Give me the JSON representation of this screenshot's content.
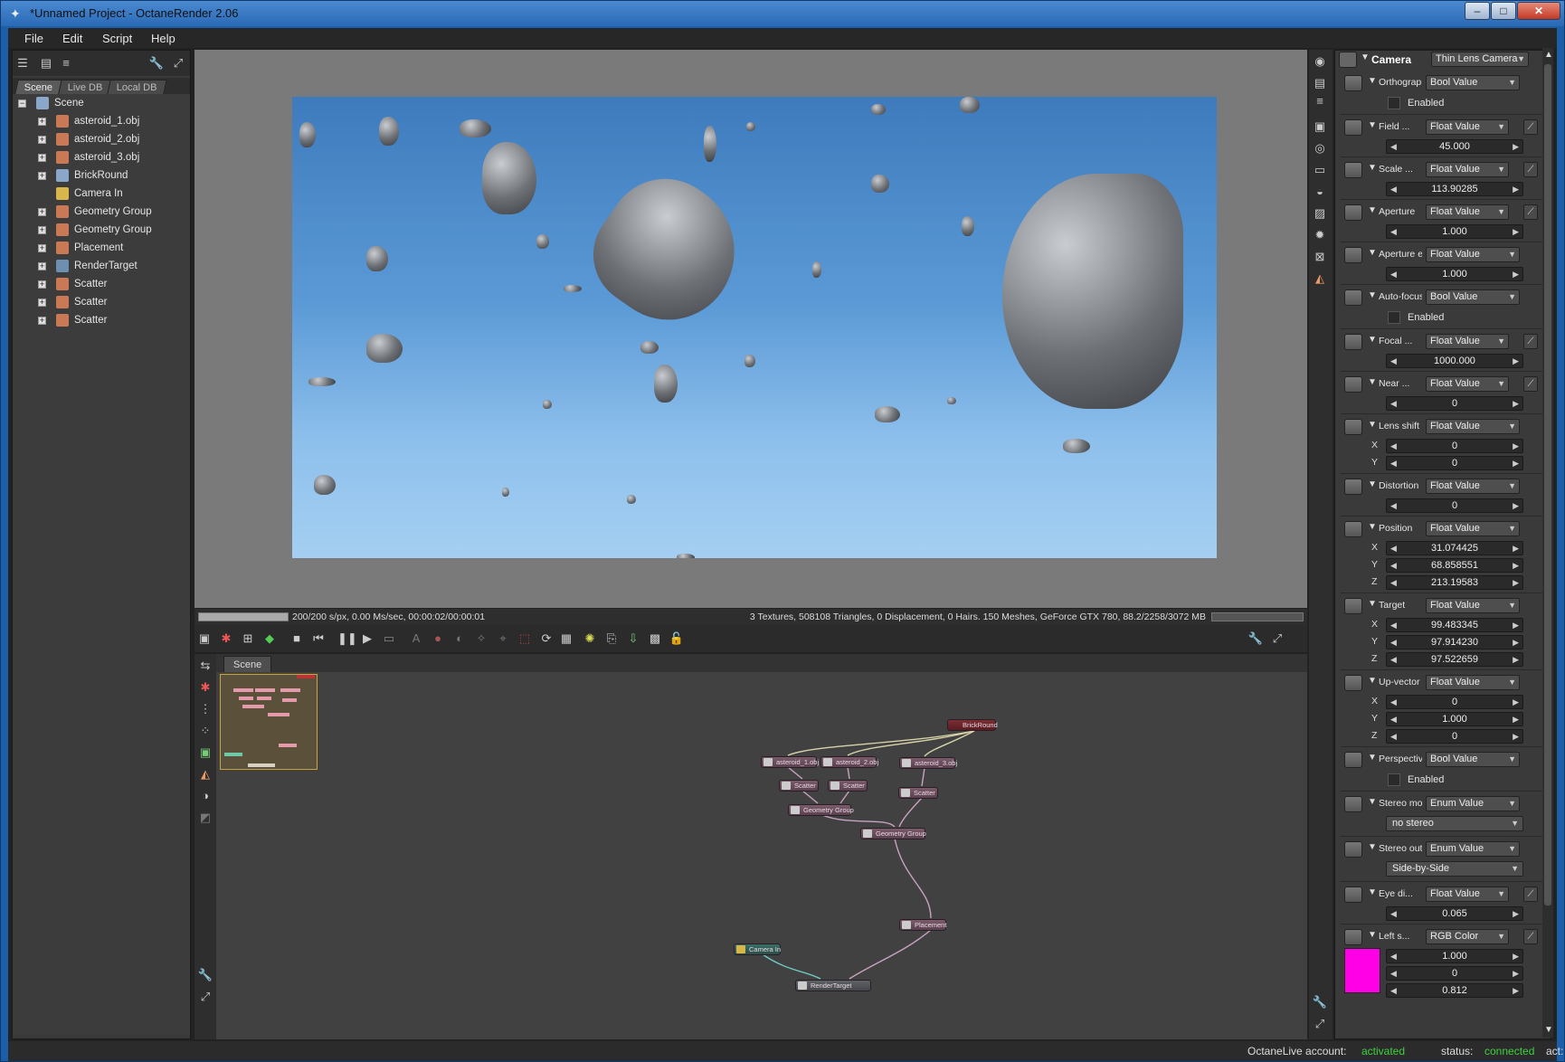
{
  "window": {
    "title": "*Unnamed Project - OctaneRender 2.06",
    "min": "–",
    "max": "□",
    "close": "✕"
  },
  "menu": [
    "File",
    "Edit",
    "Script",
    "Help"
  ],
  "left_panel": {
    "tabs": [
      "Scene",
      "Live DB",
      "Local DB"
    ],
    "tree": [
      {
        "label": "Scene",
        "expander": "−",
        "icon_color": "#8aa6c8"
      },
      {
        "label": "asteroid_1.obj",
        "expander": "+",
        "icon_color": "#c97a55"
      },
      {
        "label": "asteroid_2.obj",
        "expander": "+",
        "icon_color": "#c97a55"
      },
      {
        "label": "asteroid_3.obj",
        "expander": "+",
        "icon_color": "#c97a55"
      },
      {
        "label": "BrickRound",
        "expander": "+",
        "icon_color": "#8aa6c8"
      },
      {
        "label": "Camera In",
        "expander": "",
        "icon_color": "#d9b64a"
      },
      {
        "label": "Geometry Group",
        "expander": "+",
        "icon_color": "#c97a55"
      },
      {
        "label": "Geometry Group",
        "expander": "+",
        "icon_color": "#c97a55"
      },
      {
        "label": "Placement",
        "expander": "+",
        "icon_color": "#c97a55"
      },
      {
        "label": "RenderTarget",
        "expander": "+",
        "icon_color": "#6d8fb0"
      },
      {
        "label": "Scatter",
        "expander": "+",
        "icon_color": "#c97a55"
      },
      {
        "label": "Scatter",
        "expander": "+",
        "icon_color": "#c97a55"
      },
      {
        "label": "Scatter",
        "expander": "+",
        "icon_color": "#c97a55"
      }
    ]
  },
  "viewport": {
    "status_left": "200/200 s/px, 0.00 Ms/sec, 00:00:02/00:00:01",
    "status_right": "3 Textures, 508108 Triangles, 0 Displacement, 0 Hairs. 150 Meshes, GeForce GTX 780, 88.2/2258/3072 MB",
    "progress": 1.0
  },
  "graph": {
    "tab": "Scene",
    "nodes": {
      "brickround": "BrickRound",
      "ast1": "asteroid_1.obj",
      "ast2": "asteroid_2.obj",
      "ast3": "asteroid_3.obj",
      "scatter1": "Scatter",
      "scatter2": "Scatter",
      "scatter3": "Scatter",
      "geo1": "Geometry Group",
      "geo2": "Geometry Group",
      "placement": "Placement",
      "camera": "Camera In",
      "rendertarget": "RenderTarget"
    }
  },
  "inspector": {
    "header_label": "Camera",
    "header_type": "Thin Lens Camera",
    "params": {
      "orthographic": {
        "label": "Orthographic",
        "type": "Bool Value",
        "check": "Enabled"
      },
      "field": {
        "label": "Field ...",
        "type": "Float Value",
        "value": "45.000"
      },
      "scale": {
        "label": "Scale ...",
        "type": "Float Value",
        "value": "113.90285"
      },
      "aperture": {
        "label": "Aperture",
        "type": "Float Value",
        "value": "1.000"
      },
      "aperture_edge": {
        "label": "Aperture edge",
        "type": "Float Value",
        "value": "1.000"
      },
      "autofocus": {
        "label": "Auto-focus",
        "type": "Bool Value",
        "check": "Enabled"
      },
      "focal": {
        "label": "Focal ...",
        "type": "Float Value",
        "value": "1000.000"
      },
      "near": {
        "label": "Near ...",
        "type": "Float Value",
        "value": "0"
      },
      "lens_shift": {
        "label": "Lens shift",
        "type": "Float Value",
        "x": "0",
        "y": "0"
      },
      "distortion": {
        "label": "Distortion",
        "type": "Float Value",
        "value": "0"
      },
      "position": {
        "label": "Position",
        "type": "Float Value",
        "x": "31.074425",
        "y": "68.858551",
        "z": "213.19583"
      },
      "target": {
        "label": "Target",
        "type": "Float Value",
        "x": "99.483345",
        "y": "97.914230",
        "z": "97.522659"
      },
      "upvector": {
        "label": "Up-vector",
        "type": "Float Value",
        "x": "0",
        "y": "1.000",
        "z": "0"
      },
      "perspective": {
        "label": "Perspective ...",
        "type": "Bool Value",
        "check": "Enabled"
      },
      "stereo_mode": {
        "label": "Stereo mode",
        "type": "Enum Value",
        "value": "no stereo"
      },
      "stereo_output": {
        "label": "Stereo output",
        "type": "Enum Value",
        "value": "Side-by-Side"
      },
      "eye": {
        "label": "Eye di...",
        "type": "Float Value",
        "value": "0.065"
      },
      "left": {
        "label": "Left s...",
        "type": "RGB Color",
        "r": "1.000",
        "g": "0",
        "b": "0.812",
        "swatch": "#ff00e6"
      }
    }
  },
  "status": {
    "account_label": "OctaneLive account:",
    "account_value": "activated",
    "status_label": "status:",
    "status_value": "connected",
    "act_label": "act:",
    "ok_color": "#3fd13f"
  },
  "axes": {
    "x": "X",
    "y": "Y",
    "z": "Z"
  }
}
